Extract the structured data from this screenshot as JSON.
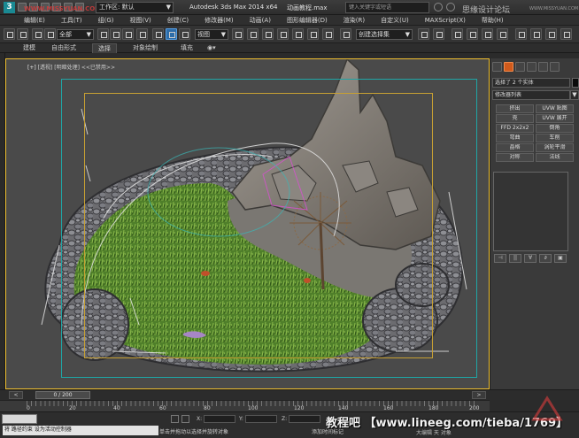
{
  "title_bar": {
    "workspace": "工作区: 默认",
    "window_title": "Autodesk 3ds Max  2014 x64",
    "file_name": "动画教程.max",
    "search_placeholder": "键入关键字或短语",
    "forum_watermark": "WWW.MISSYUAN.COM",
    "site_watermark": "思缘设计论坛",
    "site_watermark_small": "WWW.MISSYUAN.COM"
  },
  "menu": [
    "编辑(E)",
    "工具(T)",
    "组(G)",
    "视图(V)",
    "创建(C)",
    "修改器(M)",
    "动画(A)",
    "图形编辑器(D)",
    "渲染(R)",
    "自定义(U)",
    "MAXScript(X)",
    "帮助(H)"
  ],
  "toolbar": {
    "filter_value": "全部",
    "refcoord_value": "视图",
    "named_selection": "创建选择集"
  },
  "ribbon_tabs": [
    "建模",
    "自由形式",
    "选择",
    "对象绘制",
    "填充"
  ],
  "ribbon_active": "选择",
  "viewport": {
    "label_plus": "[+]",
    "label_view": "[透视]",
    "label_shade": "[明暗处理]",
    "label_extra": "<<已禁用>>"
  },
  "command_panel": {
    "object_name": "选择了 2 个实体",
    "modifier_list": "修改器列表",
    "buttons": [
      "挤出",
      "UVW 贴图",
      "壳",
      "UVW 展开",
      "FFD 2x2x2",
      "倒角",
      "弯曲",
      "车削",
      "晶格",
      "涡轮平滑",
      "对称",
      "法线"
    ],
    "stack_tools": [
      "⊣",
      "||",
      "∀",
      "∂",
      "▣"
    ]
  },
  "timeline": {
    "frame_display": "0 / 200",
    "left_arrow": "<",
    "right_arrow": ">",
    "ruler_labels": [
      "0",
      "20",
      "40",
      "60",
      "80",
      "100",
      "120",
      "140",
      "160",
      "180",
      "200"
    ]
  },
  "status": {
    "status_line": "将 路径约束 设为活动控制器",
    "prompt": "单击并拖动以选择并旋转对象",
    "coord_x": "X:",
    "coord_y": "Y:",
    "coord_z": "Z:",
    "add_time_tag": "添加时间标记",
    "watermark_big": "教程吧 【www.lineeg.com/tieba/1769】",
    "watermark_sub": "大编辑 天 对象 "
  },
  "colors": {
    "accent_blue": "#2e6da8",
    "viewport_border": "#f0c030",
    "safe_frame_cyan": "#1fa6a6",
    "safe_frame_gold": "#c7a033",
    "active_tab_orange": "#d05a1c"
  }
}
